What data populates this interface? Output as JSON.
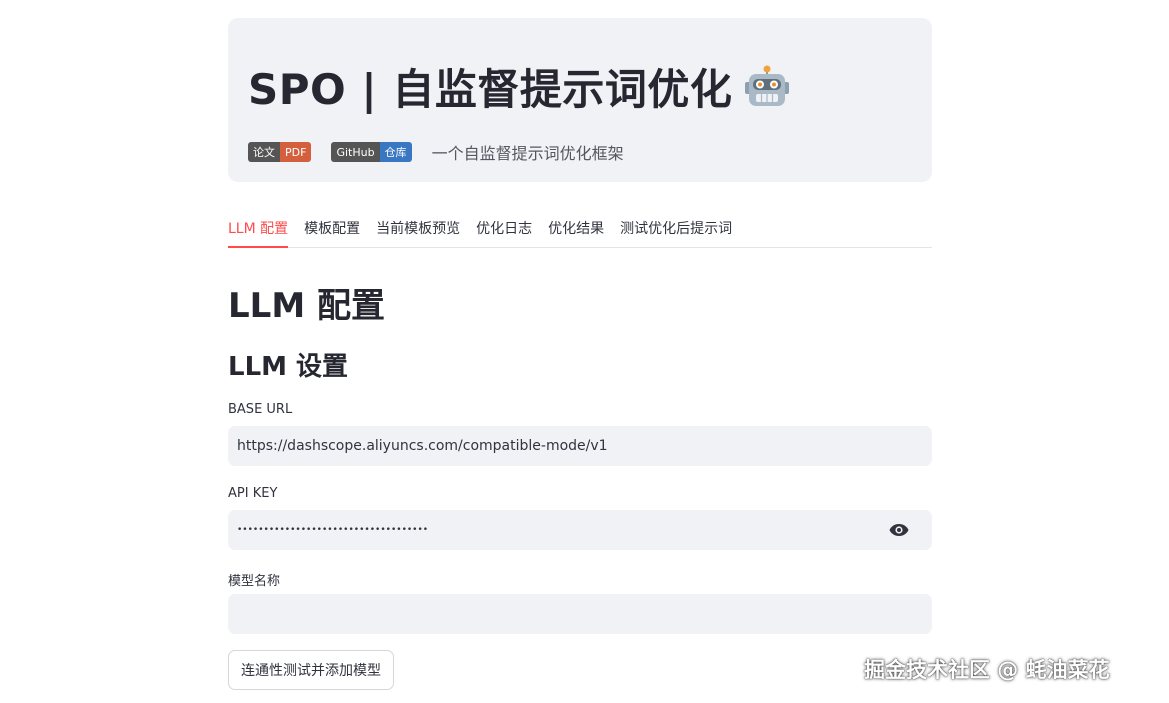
{
  "hero": {
    "title": "SPO | 自监督提示词优化",
    "title_icon": "robot-face-icon",
    "badges": [
      {
        "left": "论文",
        "right": "PDF",
        "color": "#d45f3d"
      },
      {
        "left": "GitHub",
        "right": "仓库",
        "color": "#3a77c2"
      }
    ],
    "tagline": "一个自监督提示词优化框架"
  },
  "tabs": [
    {
      "label": "LLM 配置",
      "active": true
    },
    {
      "label": "模板配置",
      "active": false
    },
    {
      "label": "当前模板预览",
      "active": false
    },
    {
      "label": "优化日志",
      "active": false
    },
    {
      "label": "优化结果",
      "active": false
    },
    {
      "label": "测试优化后提示词",
      "active": false
    }
  ],
  "main": {
    "heading": "LLM 配置",
    "subheading": "LLM 设置",
    "fields": {
      "base_url": {
        "label": "BASE URL",
        "value": "https://dashscope.aliyuncs.com/compatible-mode/v1"
      },
      "api_key": {
        "label": "API KEY",
        "value": "••••••••••••••••••••••••••••••••••••",
        "toggle_icon": "eye-icon"
      },
      "model_name": {
        "label": "模型名称",
        "value": ""
      }
    },
    "test_button": "连通性测试并添加模型"
  },
  "watermark": "掘金技术社区 @ 蚝油菜花",
  "colors": {
    "accent": "#ff4b4b",
    "hero_bg": "#f0f2f6",
    "input_bg": "#f0f2f6"
  }
}
